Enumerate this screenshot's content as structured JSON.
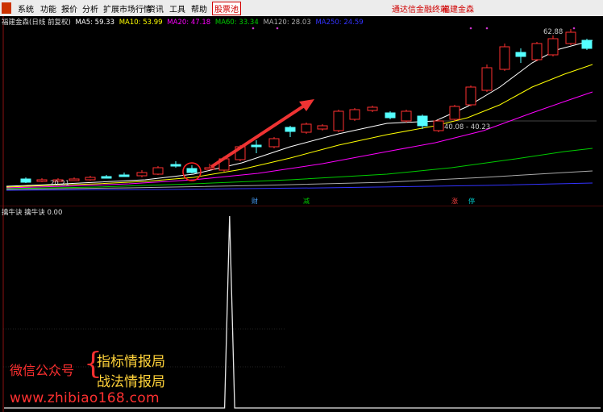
{
  "menu": {
    "items": [
      "系统",
      "功能",
      "报价",
      "分析",
      "扩展市场行情",
      "资讯",
      "工具",
      "帮助"
    ],
    "active_item": "股票池",
    "right_links": [
      "通达信金融终端",
      "福建金森"
    ]
  },
  "main": {
    "title": "福建金森(日线 前复权)",
    "ma_labels": [
      {
        "text": "MA5: 59.33",
        "color": "#ffffff"
      },
      {
        "text": "MA10: 53.99",
        "color": "#ffff00"
      },
      {
        "text": "MA20: 47.18",
        "color": "#ff00ff"
      },
      {
        "text": "MA60: 33.34",
        "color": "#00cc00"
      },
      {
        "text": "MA120: 28.03",
        "color": "#aaaaaa"
      },
      {
        "text": "MA250: 24.59",
        "color": "#3333ff"
      }
    ],
    "price_labels": {
      "high": "62.88",
      "low": "20.21",
      "range": "40.08 - 40.23"
    },
    "event_markers": [
      {
        "text": "财",
        "color": "#4aa3ff"
      },
      {
        "text": "减",
        "color": "#00cc00"
      },
      {
        "text": "涨",
        "color": "#ff4040"
      },
      {
        "text": "停",
        "color": "#00cccc"
      }
    ],
    "candle_colors": {
      "up": "#ff3030",
      "down": "#54ffff"
    }
  },
  "sub": {
    "indicator_name": "擒牛诀",
    "line_name": "擒牛诀",
    "value": "0.00"
  },
  "watermark": {
    "prefix": "微信公众号",
    "brace": "{",
    "line1": "指标情报局",
    "line2": "战法情报局",
    "url": "www.zhibiao168.com"
  },
  "chart_data": {
    "type": "line",
    "title": "擒牛诀",
    "xlabel": "",
    "ylabel": "",
    "series": [
      {
        "name": "擒牛诀",
        "values": [
          0,
          0,
          0,
          0,
          0,
          0,
          0,
          0,
          0,
          0,
          0,
          0,
          0,
          0,
          0,
          0,
          0,
          0,
          0,
          0,
          0,
          0,
          0,
          0,
          0,
          0,
          0,
          0,
          0,
          0,
          0,
          0,
          0,
          0,
          0,
          0,
          0,
          0,
          0,
          0,
          0,
          0,
          0,
          0,
          0,
          1,
          0,
          0,
          0,
          0,
          0,
          0,
          0,
          0,
          0,
          0,
          0,
          0,
          0,
          0,
          0,
          0,
          0,
          0,
          0,
          0,
          0,
          0,
          0,
          0,
          0,
          0,
          0,
          0,
          0,
          0,
          0,
          0,
          0,
          0,
          0,
          0,
          0,
          0,
          0,
          0,
          0,
          0,
          0,
          0,
          0,
          0,
          0,
          0,
          0,
          0,
          0,
          0,
          0,
          0,
          0,
          0,
          0,
          0,
          0,
          0,
          0,
          0,
          0,
          0,
          0,
          0,
          0,
          0,
          0,
          0,
          0,
          0,
          0,
          0
        ]
      }
    ],
    "ylim": [
      0,
      1
    ]
  }
}
